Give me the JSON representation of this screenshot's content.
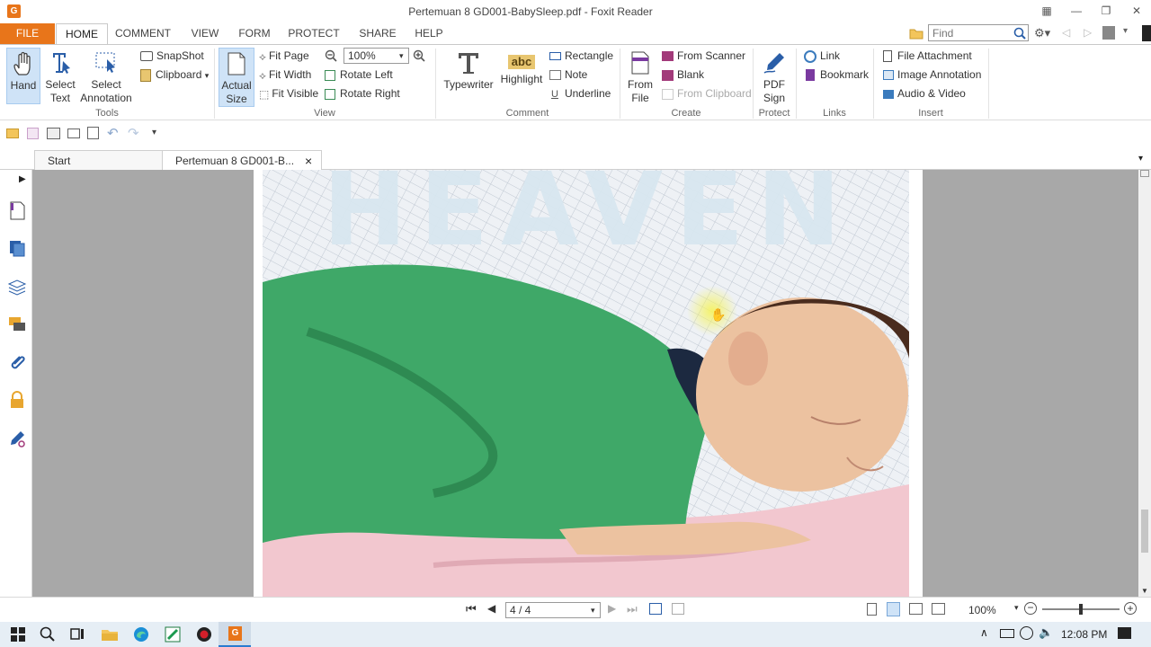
{
  "window": {
    "title": "Pertemuan 8  GD001-BabySleep.pdf - Foxit Reader",
    "app_icon": "G"
  },
  "ribbon_tabs": [
    "FILE",
    "HOME",
    "COMMENT",
    "VIEW",
    "FORM",
    "PROTECT",
    "SHARE",
    "HELP"
  ],
  "active_tab": "HOME",
  "find": {
    "placeholder": "Find"
  },
  "tools": {
    "hand": "Hand",
    "select_text_1": "Select",
    "select_text_2": "Text",
    "select_annot_1": "Select",
    "select_annot_2": "Annotation",
    "snapshot": "SnapShot",
    "clipboard": "Clipboard",
    "label": "Tools"
  },
  "view": {
    "actual_size_1": "Actual",
    "actual_size_2": "Size",
    "fit_page": "Fit Page",
    "fit_width": "Fit Width",
    "fit_visible": "Fit Visible",
    "zoom_value": "100%",
    "rotate_left": "Rotate Left",
    "rotate_right": "Rotate Right",
    "label": "View"
  },
  "comment": {
    "typewriter": "Typewriter",
    "highlight": "Highlight",
    "highlight_icon_text": "abc",
    "rectangle": "Rectangle",
    "note": "Note",
    "underline": "Underline",
    "label": "Comment"
  },
  "create": {
    "from_file_1": "From",
    "from_file_2": "File",
    "from_scanner": "From Scanner",
    "blank": "Blank",
    "from_clipboard": "From Clipboard",
    "label": "Create"
  },
  "protect": {
    "pdf_sign_1": "PDF",
    "pdf_sign_2": "Sign",
    "label": "Protect"
  },
  "links": {
    "link": "Link",
    "bookmark": "Bookmark",
    "label": "Links"
  },
  "insert": {
    "file_attachment": "File Attachment",
    "image_annotation": "Image Annotation",
    "audio_video": "Audio & Video",
    "label": "Insert"
  },
  "doc_tabs": {
    "start": "Start",
    "current": "Pertemuan 8  GD001-B...",
    "close": "×"
  },
  "page": {
    "heading": "HEAVEN"
  },
  "status": {
    "page_indicator": "4 / 4",
    "zoom": "100%"
  },
  "taskbar": {
    "time": "12:08 PM"
  },
  "colors": {
    "accent": "#e8751a",
    "ribbon_active": "#cfe3f7",
    "doc_background": "#a8a8a8"
  }
}
